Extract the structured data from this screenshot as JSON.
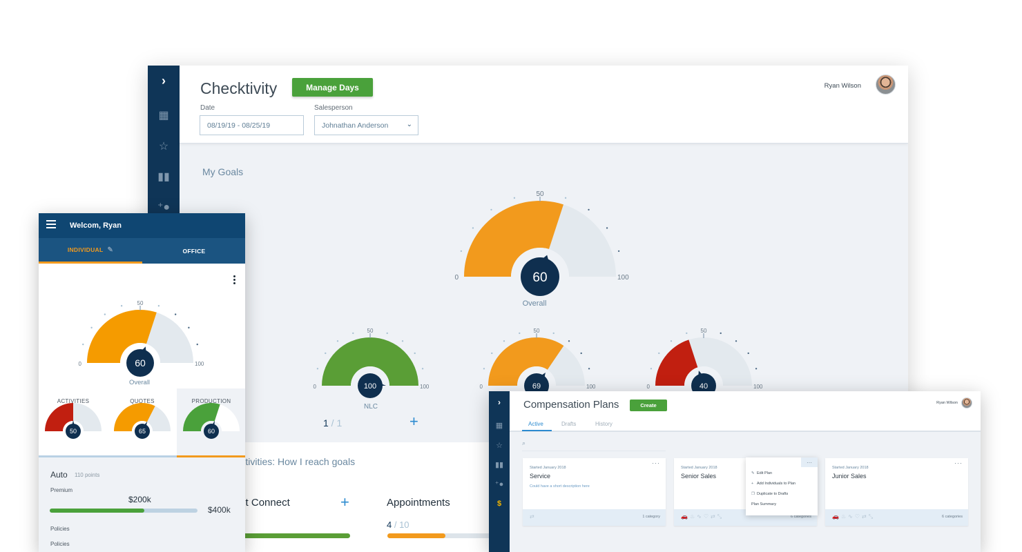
{
  "desktop": {
    "sidebar": {
      "expand_icon": "chevron-right",
      "items": [
        {
          "name": "dashboard",
          "icon": "▦"
        },
        {
          "name": "goals",
          "icon": "☆"
        },
        {
          "name": "reports",
          "icon": "▮"
        },
        {
          "name": "add-user",
          "icon": "+●"
        }
      ]
    },
    "title": "Checktivity",
    "manage_days_label": "Manage Days",
    "date_label": "Date",
    "date_value": "08/19/19 - 08/25/19",
    "salesperson_label": "Salesperson",
    "salesperson_value": "Johnathan Anderson",
    "user_name": "Ryan Wilson",
    "section_title": "My Goals",
    "overall_caption": "Overall",
    "gauges": {
      "overall": {
        "value": 60,
        "color": "#f29a1d"
      },
      "nlc": {
        "value": 100,
        "color": "#5a9e36",
        "label": "NLC"
      },
      "second": {
        "value": 69,
        "color": "#f29a1d"
      },
      "third": {
        "value": 40,
        "color": "#c11f10"
      }
    },
    "scale": {
      "min": "0",
      "mid": "50",
      "max": "100"
    },
    "pager": {
      "current": "1",
      "sep_total": " / 1"
    },
    "activities_title": "Activities: How I reach goals",
    "activities": [
      {
        "name": "Contact Connect",
        "progress": 1.0,
        "color": "#5a9e36"
      },
      {
        "name": "Appointments",
        "current": "4",
        "sep_total": " / 10",
        "progress": 0.4,
        "color": "#f29a1d"
      }
    ]
  },
  "mobile": {
    "welcome": "Welcom, Ryan",
    "tabs": [
      {
        "label": "INDIVIDUAL",
        "active": true
      },
      {
        "label": "OFFICE",
        "active": false
      }
    ],
    "overall": {
      "value": 60,
      "color": "#f59b00",
      "label": "Overall"
    },
    "scale": {
      "min": "0",
      "mid": "50",
      "max": "100"
    },
    "categories": [
      {
        "label": "ACTIVITIES",
        "value": 50,
        "color": "#c11f10"
      },
      {
        "label": "QUOTES",
        "value": 65,
        "color": "#f59b00"
      },
      {
        "label": "PRODUCTION",
        "value": 60,
        "color": "#4aa13b",
        "selected": true
      }
    ],
    "detail": {
      "line": "Auto",
      "points": "110 points",
      "premium_label": "Premium",
      "premium_current": "$200k",
      "premium_goal": "$400k",
      "premium_progress": 0.64,
      "rows": [
        "Policies",
        "Policies"
      ]
    }
  },
  "compensation": {
    "title": "Compensation Plans",
    "create_label": "Create",
    "user_name": "Ryan Wilson",
    "tabs": [
      {
        "label": "Active",
        "active": true
      },
      {
        "label": "Drafts",
        "active": false
      },
      {
        "label": "History",
        "active": false
      }
    ],
    "search_placeholder": "",
    "cards": [
      {
        "started": "Started January 2018",
        "name": "Service",
        "description": "Could have a short description here",
        "icons": "⇄",
        "categories": "1 category"
      },
      {
        "started": "Started January 2018",
        "name": "Senior Sales",
        "description": "",
        "icons": "🚗♨∿♡⇄⤡",
        "categories": "6 categories"
      },
      {
        "started": "Started January 2018",
        "name": "Junior Sales",
        "description": "",
        "icons": "🚗♨∿♡⇄⤡",
        "categories": "6 categories"
      }
    ],
    "menu": [
      {
        "icon": "✎",
        "label": "Edit Plan"
      },
      {
        "icon": "+",
        "label": "Add Individuals to Plan"
      },
      {
        "icon": "❐",
        "label": "Duplicate to Drafts"
      },
      {
        "icon": "",
        "label": "Plan Summary"
      }
    ]
  }
}
